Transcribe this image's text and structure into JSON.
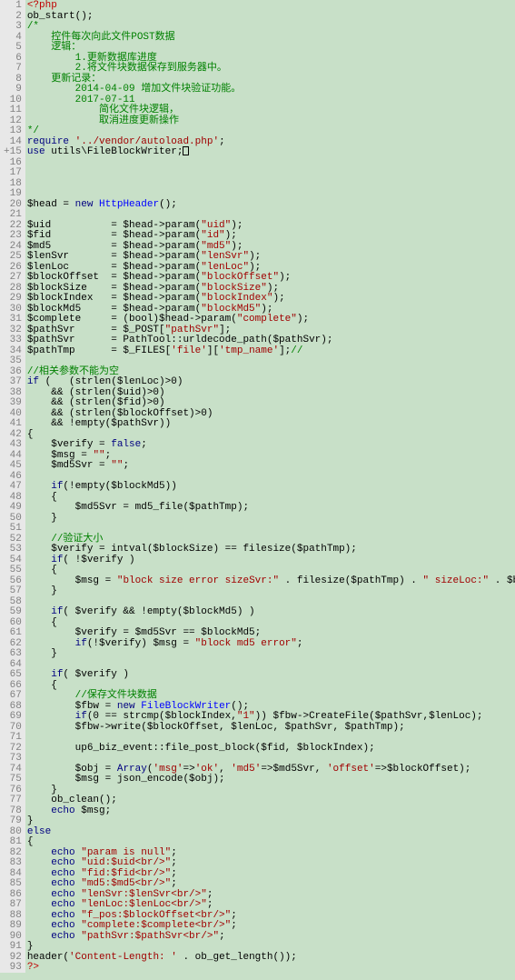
{
  "lines": [
    {
      "n": 1,
      "html": "<span class='php'>&lt;?php</span>"
    },
    {
      "n": 2,
      "html": "ob_start();"
    },
    {
      "n": 3,
      "html": "<span class='cmt'>/*</span>"
    },
    {
      "n": 4,
      "html": "<span class='cmt'>    控件每次向此文件POST数据</span>"
    },
    {
      "n": 5,
      "html": "<span class='cmt'>    逻辑：</span>"
    },
    {
      "n": 6,
      "html": "<span class='cmt'>        1.更新数据库进度</span>"
    },
    {
      "n": 7,
      "html": "<span class='cmt'>        2.将文件块数据保存到服务器中。</span>"
    },
    {
      "n": 8,
      "html": "<span class='cmt'>    更新记录：</span>"
    },
    {
      "n": 9,
      "html": "<span class='cmt'>        2014-04-09 增加文件块验证功能。</span>"
    },
    {
      "n": 10,
      "html": "<span class='cmt'>        2017-07-11</span>"
    },
    {
      "n": 11,
      "html": "<span class='cmt'>            简化文件块逻辑，</span>"
    },
    {
      "n": 12,
      "html": "<span class='cmt'>            取消进度更新操作</span>"
    },
    {
      "n": 13,
      "html": "<span class='cmt'>*/</span>"
    },
    {
      "n": 14,
      "html": "<span class='kw'>require</span> <span class='str'>'../vendor/autoload.php'</span>;"
    },
    {
      "n": 15,
      "html": "<span class='kw'>use</span> utils\\FileBlockWriter;<span class='cursor'></span>",
      "mark": "+"
    },
    {
      "n": 16,
      "html": ""
    },
    {
      "n": 17,
      "html": ""
    },
    {
      "n": 18,
      "html": ""
    },
    {
      "n": 19,
      "html": ""
    },
    {
      "n": 20,
      "html": "$head = <span class='kw'>new</span> <span class='num'>HttpHeader</span>();"
    },
    {
      "n": 21,
      "html": ""
    },
    {
      "n": 22,
      "html": "$uid          = $head-&gt;param(<span class='str'>\"uid\"</span>);"
    },
    {
      "n": 23,
      "html": "$fid          = $head-&gt;param(<span class='str'>\"id\"</span>);"
    },
    {
      "n": 24,
      "html": "$md5          = $head-&gt;param(<span class='str'>\"md5\"</span>);"
    },
    {
      "n": 25,
      "html": "$lenSvr       = $head-&gt;param(<span class='str'>\"lenSvr\"</span>);"
    },
    {
      "n": 26,
      "html": "$lenLoc       = $head-&gt;param(<span class='str'>\"lenLoc\"</span>);"
    },
    {
      "n": 27,
      "html": "$blockOffset  = $head-&gt;param(<span class='str'>\"blockOffset\"</span>);"
    },
    {
      "n": 28,
      "html": "$blockSize    = $head-&gt;param(<span class='str'>\"blockSize\"</span>);"
    },
    {
      "n": 29,
      "html": "$blockIndex   = $head-&gt;param(<span class='str'>\"blockIndex\"</span>);"
    },
    {
      "n": 30,
      "html": "$blockMd5     = $head-&gt;param(<span class='str'>\"blockMd5\"</span>);"
    },
    {
      "n": 31,
      "html": "$complete     = (bool)$head-&gt;param(<span class='str'>\"complete\"</span>);"
    },
    {
      "n": 32,
      "html": "$pathSvr      = $_POST[<span class='str'>\"pathSvr\"</span>];"
    },
    {
      "n": 33,
      "html": "$pathSvr      = PathTool::urldecode_path($pathSvr);"
    },
    {
      "n": 34,
      "html": "$pathTmp      = $_FILES[<span class='str'>'file'</span>][<span class='str'>'tmp_name'</span>];<span class='cmt'>//</span>"
    },
    {
      "n": 35,
      "html": ""
    },
    {
      "n": 36,
      "html": "<span class='cmt'>//相关参数不能为空</span>"
    },
    {
      "n": 37,
      "html": "<span class='kw'>if</span> (   (strlen($lenLoc)&gt;0)"
    },
    {
      "n": 38,
      "html": "    &amp;&amp; (strlen($uid)&gt;0)"
    },
    {
      "n": 39,
      "html": "    &amp;&amp; (strlen($fid)&gt;0)"
    },
    {
      "n": 40,
      "html": "    &amp;&amp; (strlen($blockOffset)&gt;0)"
    },
    {
      "n": 41,
      "html": "    &amp;&amp; !empty($pathSvr))"
    },
    {
      "n": 42,
      "html": "{"
    },
    {
      "n": 43,
      "html": "    $verify = <span class='kw'>false</span>;"
    },
    {
      "n": 44,
      "html": "    $msg = <span class='str'>\"\"</span>;"
    },
    {
      "n": 45,
      "html": "    $md5Svr = <span class='str'>\"\"</span>;"
    },
    {
      "n": 46,
      "html": ""
    },
    {
      "n": 47,
      "html": "    <span class='kw'>if</span>(!empty($blockMd5))"
    },
    {
      "n": 48,
      "html": "    {"
    },
    {
      "n": 49,
      "html": "        $md5Svr = md5_file($pathTmp);"
    },
    {
      "n": 50,
      "html": "    }"
    },
    {
      "n": 51,
      "html": ""
    },
    {
      "n": 52,
      "html": "    <span class='cmt'>//验证大小</span>"
    },
    {
      "n": 53,
      "html": "    $verify = intval($blockSize) == filesize($pathTmp);"
    },
    {
      "n": 54,
      "html": "    <span class='kw'>if</span>( !$verify )"
    },
    {
      "n": 55,
      "html": "    {"
    },
    {
      "n": 56,
      "html": "        $msg = <span class='str'>\"block size error sizeSvr:\"</span> . filesize($pathTmp) . <span class='str'>\" sizeLoc:\"</span> . $blockSize;"
    },
    {
      "n": 57,
      "html": "    }"
    },
    {
      "n": 58,
      "html": ""
    },
    {
      "n": 59,
      "html": "    <span class='kw'>if</span>( $verify &amp;&amp; !empty($blockMd5) )"
    },
    {
      "n": 60,
      "html": "    {"
    },
    {
      "n": 61,
      "html": "        $verify = $md5Svr == $blockMd5;"
    },
    {
      "n": 62,
      "html": "        <span class='kw'>if</span>(!$verify) $msg = <span class='str'>\"block md5 error\"</span>;"
    },
    {
      "n": 63,
      "html": "    }"
    },
    {
      "n": 64,
      "html": ""
    },
    {
      "n": 65,
      "html": "    <span class='kw'>if</span>( $verify )"
    },
    {
      "n": 66,
      "html": "    {"
    },
    {
      "n": 67,
      "html": "        <span class='cmt'>//保存文件块数据</span>"
    },
    {
      "n": 68,
      "html": "        $fbw = <span class='kw'>new</span> <span class='num'>FileBlockWriter</span>();"
    },
    {
      "n": 69,
      "html": "        <span class='kw'>if</span>(0 == strcmp($blockIndex,<span class='str'>\"1\"</span>)) $fbw-&gt;CreateFile($pathSvr,$lenLoc);"
    },
    {
      "n": 70,
      "html": "        $fbw-&gt;write($blockOffset, $lenLoc, $pathSvr, $pathTmp);"
    },
    {
      "n": 71,
      "html": ""
    },
    {
      "n": 72,
      "html": "        up6_biz_event::file_post_block($fid, $blockIndex);"
    },
    {
      "n": 73,
      "html": ""
    },
    {
      "n": 74,
      "html": "        $obj = <span class='kw'>Array</span>(<span class='str'>'msg'</span>=&gt;<span class='str'>'ok'</span>, <span class='str'>'md5'</span>=&gt;$md5Svr, <span class='str'>'offset'</span>=&gt;$blockOffset);"
    },
    {
      "n": 75,
      "html": "        $msg = json_encode($obj);"
    },
    {
      "n": 76,
      "html": "    }"
    },
    {
      "n": 77,
      "html": "    ob_clean();"
    },
    {
      "n": 78,
      "html": "    <span class='kw'>echo</span> $msg;"
    },
    {
      "n": 79,
      "html": "}"
    },
    {
      "n": 80,
      "html": "<span class='kw'>else</span>"
    },
    {
      "n": 81,
      "html": "{"
    },
    {
      "n": 82,
      "html": "    <span class='kw'>echo</span> <span class='str'>\"param is null\"</span>;"
    },
    {
      "n": 83,
      "html": "    <span class='kw'>echo</span> <span class='str'>\"uid:$uid&lt;br/&gt;\"</span>;"
    },
    {
      "n": 84,
      "html": "    <span class='kw'>echo</span> <span class='str'>\"fid:$fid&lt;br/&gt;\"</span>;"
    },
    {
      "n": 85,
      "html": "    <span class='kw'>echo</span> <span class='str'>\"md5:$md5&lt;br/&gt;\"</span>;"
    },
    {
      "n": 86,
      "html": "    <span class='kw'>echo</span> <span class='str'>\"lenSvr:$lenSvr&lt;br/&gt;\"</span>;"
    },
    {
      "n": 87,
      "html": "    <span class='kw'>echo</span> <span class='str'>\"lenLoc:$lenLoc&lt;br/&gt;\"</span>;"
    },
    {
      "n": 88,
      "html": "    <span class='kw'>echo</span> <span class='str'>\"f_pos:$blockOffset&lt;br/&gt;\"</span>;"
    },
    {
      "n": 89,
      "html": "    <span class='kw'>echo</span> <span class='str'>\"complete:$complete&lt;br/&gt;\"</span>;"
    },
    {
      "n": 90,
      "html": "    <span class='kw'>echo</span> <span class='str'>\"pathSvr:$pathSvr&lt;br/&gt;\"</span>;"
    },
    {
      "n": 91,
      "html": "}"
    },
    {
      "n": 92,
      "html": "header(<span class='str'>'Content-Length: '</span> . ob_get_length());"
    },
    {
      "n": 93,
      "html": "<span class='php'>?&gt;</span>"
    }
  ]
}
